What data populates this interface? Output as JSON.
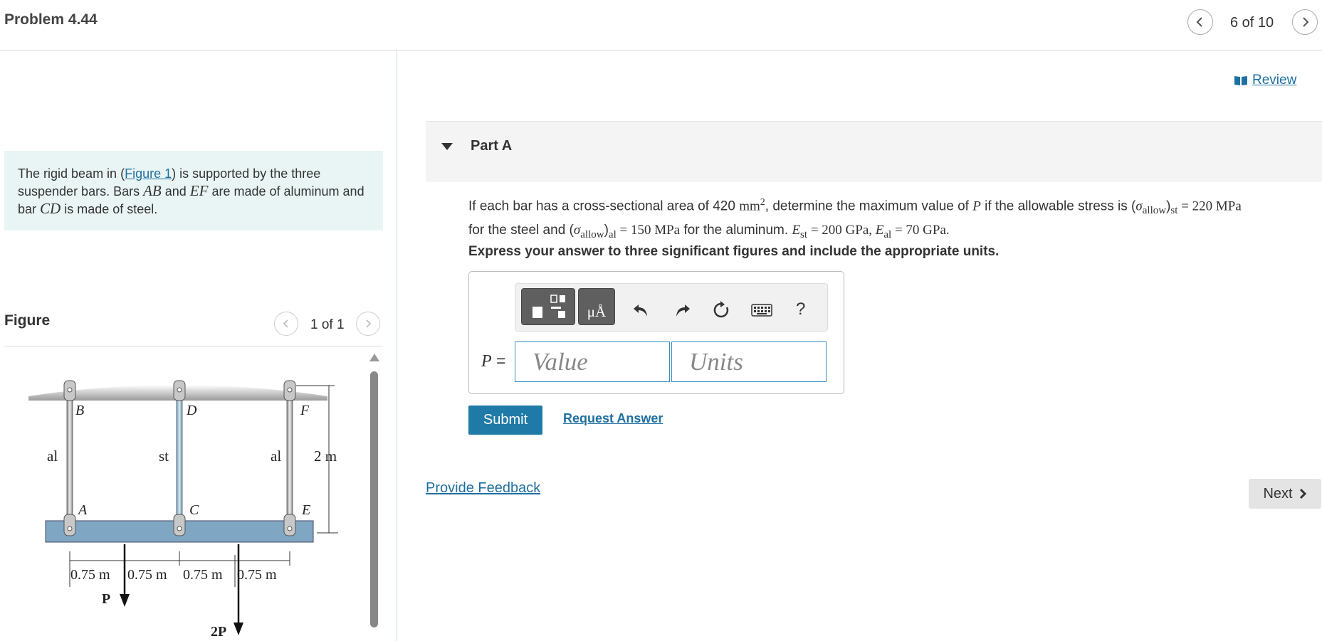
{
  "header": {
    "title": "Problem 4.44",
    "counter": "6 of 10"
  },
  "left": {
    "intro": {
      "p1": "The rigid beam in (",
      "figure_link": "Figure 1",
      "p2": ") is supported by the three suspender bars. Bars ",
      "ab": "AB",
      "p3": " and ",
      "ef": "EF",
      "p4": " are made of aluminum and bar ",
      "cd": "CD",
      "p5": " is made of steel."
    },
    "figure": {
      "label": "Figure",
      "counter": "1 of 1",
      "diagram": {
        "point_labels": [
          "B",
          "D",
          "F",
          "A",
          "C",
          "E"
        ],
        "material_labels": [
          "al",
          "st",
          "al"
        ],
        "height_label": "2 m",
        "spacing_labels": [
          "0.75 m",
          "0.75 m",
          "0.75 m",
          "0.75 m"
        ],
        "load_labels": [
          "P",
          "2P"
        ]
      }
    }
  },
  "right": {
    "review": "Review",
    "part_label": "Part A",
    "question": {
      "q1": "If each bar has a cross-sectional area of 420 ",
      "mm": "mm",
      "sq": "2",
      "q2": ", determine the maximum value of ",
      "P": "P",
      "q3": " if the allowable stress is (",
      "sigma1": "σ",
      "allow1": "allow",
      "st_sub": "st",
      "eq1": " = 220 MPa",
      "q4": " for the steel and (",
      "sigma2": "σ",
      "allow2": "allow",
      "al_sub": "al",
      "eq2": " = 150 MPa",
      "q5": " for the aluminum. ",
      "E1": "E",
      "E1sub": "st",
      "eq3": " = 200 GPa, ",
      "E2": "E",
      "E2sub": "al",
      "eq4": " = 70 GPa."
    },
    "instruction": "Express your answer to three significant figures and include the appropriate units.",
    "toolbar": {
      "units_btn": "μÅ",
      "help": "?"
    },
    "p_label": "P =",
    "value_placeholder": "Value",
    "units_placeholder": "Units",
    "submit": "Submit",
    "request_answer": "Request Answer",
    "feedback": "Provide Feedback",
    "next": "Next"
  },
  "colors": {
    "link": "#1f6fa0",
    "submit_bg": "#1f7aa8",
    "intro_bg": "#e9f5f4",
    "beam": "#7fa7c3"
  }
}
